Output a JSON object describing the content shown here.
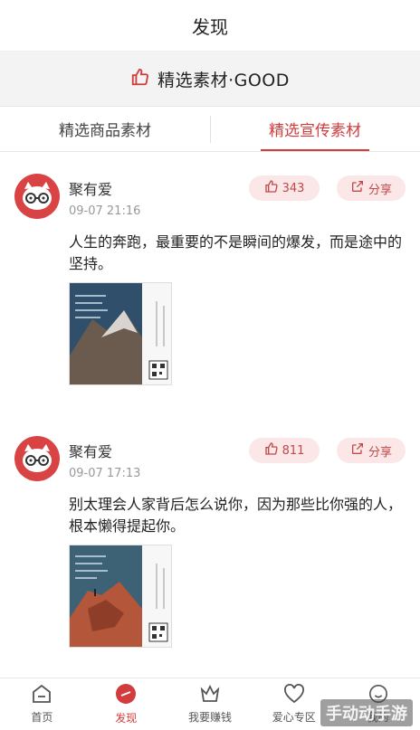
{
  "header": {
    "title": "发现"
  },
  "banner": {
    "text": "精选素材·GOOD",
    "icon": "thumbs-up-icon"
  },
  "tabs": [
    {
      "label": "精选商品素材",
      "active": false
    },
    {
      "label": "精选宣传素材",
      "active": true
    }
  ],
  "posts": [
    {
      "username": "聚有爱",
      "time": "09-07 21:16",
      "likes": "343",
      "share_label": "分享",
      "content": "人生的奔跑，最重要的不是瞬间的爆发，而是途中的坚持。"
    },
    {
      "username": "聚有爱",
      "time": "09-07 17:13",
      "likes": "811",
      "share_label": "分享",
      "content": "别太理会人家背后怎么说你，因为那些比你强的人，根本懒得提起你。"
    }
  ],
  "bottom_nav": [
    {
      "label": "首页",
      "icon": "home-icon"
    },
    {
      "label": "发现",
      "icon": "discover-icon",
      "active": true
    },
    {
      "label": "我要赚钱",
      "icon": "crown-icon"
    },
    {
      "label": "爱心专区",
      "icon": "heart-icon"
    },
    {
      "label": "我的",
      "icon": "smile-icon"
    }
  ],
  "watermark": "手动动手游",
  "colors": {
    "accent": "#d23c3c",
    "pill_bg": "#fbe7e7",
    "banner_bg": "#f3f3f3"
  }
}
